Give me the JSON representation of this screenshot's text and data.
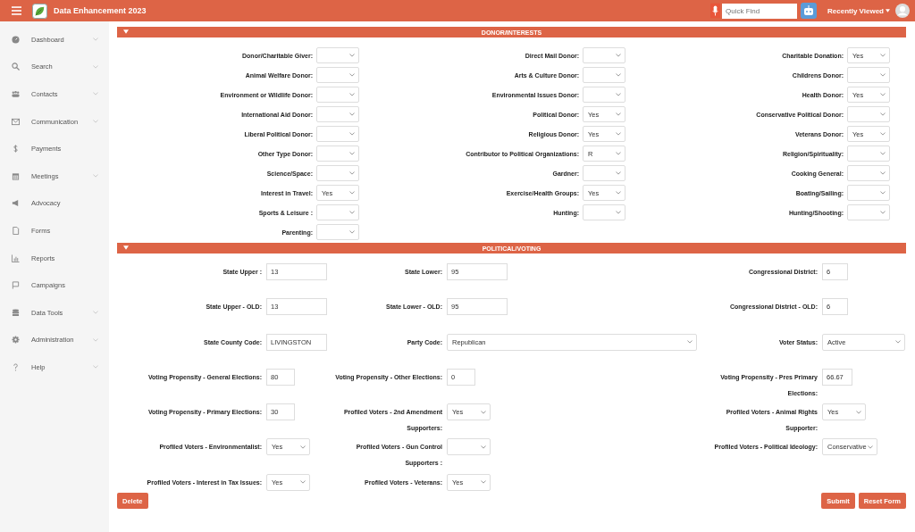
{
  "header": {
    "title": "Data Enhancement 2023",
    "search": {
      "placeholder": "Quick Find"
    },
    "recent": "Recently Viewed"
  },
  "sidebar": {
    "items": [
      {
        "label": "Dashboard",
        "has_submenu": true
      },
      {
        "label": "Search",
        "has_submenu": true
      },
      {
        "label": "Contacts",
        "has_submenu": true
      },
      {
        "label": "Communication",
        "has_submenu": true
      },
      {
        "label": "Payments",
        "has_submenu": false
      },
      {
        "label": "Meetings",
        "has_submenu": true
      },
      {
        "label": "Advocacy",
        "has_submenu": false
      },
      {
        "label": "Forms",
        "has_submenu": false
      },
      {
        "label": "Reports",
        "has_submenu": false
      },
      {
        "label": "Campaigns",
        "has_submenu": false
      },
      {
        "label": "Data Tools",
        "has_submenu": true
      },
      {
        "label": "Administration",
        "has_submenu": true
      },
      {
        "label": "Help",
        "has_submenu": true
      }
    ]
  },
  "donor_section": {
    "title": "DONOR/INTERESTS",
    "expanded": true,
    "fields": [
      {
        "label": "Donor/Charitable Giver:"
      },
      {
        "label": "Direct Mail Donor:"
      },
      {
        "label": "Charitable Donation:",
        "value": "Yes"
      },
      {
        "label": "Animal Welfare Donor:"
      },
      {
        "label": "Arts & Culture Donor:"
      },
      {
        "label": "Childrens Donor:"
      },
      {
        "label": "Environment or Wildlife Donor:"
      },
      {
        "label": "Environmental Issues Donor:"
      },
      {
        "label": "Health Donor:",
        "value": "Yes"
      },
      {
        "label": "International Aid Donor:"
      },
      {
        "label": "Political Donor:",
        "value": "Yes"
      },
      {
        "label": "Conservative Political Donor:"
      },
      {
        "label": "Liberal Political Donor:"
      },
      {
        "label": "Religious Donor:",
        "value": "Yes"
      },
      {
        "label": "Veterans Donor:",
        "value": "Yes"
      },
      {
        "label": "Other Type Donor:"
      },
      {
        "label": "Contributor to Political Organizations:",
        "value": "R"
      },
      {
        "label": "Religion/Spirituality:"
      },
      {
        "label": "Science/Space:"
      },
      {
        "label": "Gardner:"
      },
      {
        "label": "Cooking General:"
      },
      {
        "label": "Interest in Travel:",
        "value": "Yes"
      },
      {
        "label": "Exercise/Health Groups:",
        "value": "Yes"
      },
      {
        "label": "Boating/Sailing:"
      },
      {
        "label": "Sports & Leisure :"
      },
      {
        "label": "Hunting:"
      },
      {
        "label": "Hunting/Shooting:"
      },
      {
        "label": "Parenting:"
      }
    ]
  },
  "political_section": {
    "title": "POLITICAL/VOTING",
    "expanded": true,
    "rows": [
      [
        {
          "kind": "input",
          "label": "State Upper :",
          "value": "13"
        },
        {
          "kind": "input",
          "label": "State Lower:",
          "value": "95"
        },
        {
          "kind": "input",
          "label": "Congressional District:",
          "value": "6"
        }
      ],
      [
        {
          "kind": "input",
          "label": "State Upper - OLD:",
          "value": "13"
        },
        {
          "kind": "input",
          "label": "State Lower - OLD:",
          "value": "95"
        },
        {
          "kind": "input",
          "label": "Congressional District - OLD:",
          "value": "6"
        }
      ],
      [
        {
          "kind": "input",
          "label": "State County Code:",
          "value": "LIVINGSTON"
        },
        {
          "kind": "select",
          "label": "Party Code:",
          "value": "Republican"
        },
        {
          "kind": "select",
          "label": "Voter Status:",
          "value": "Active"
        }
      ],
      [
        {
          "kind": "input",
          "label": "Voting Propensity - General Elections:",
          "value": "80"
        },
        {
          "kind": "input",
          "label": "Voting Propensity - Other Elections:",
          "value": "0"
        },
        {
          "kind": "input",
          "label": "Voting Propensity - Pres Primary Elections:",
          "value": "66.67"
        }
      ],
      [
        {
          "kind": "input",
          "label": "Voting Propensity - Primary Elections:",
          "value": "30"
        },
        {
          "kind": "select",
          "label": "Profiled Voters - 2nd Amendment Supporters:",
          "value": "Yes"
        },
        {
          "kind": "select",
          "label": "Profiled Voters - Animal Rights Supporter:",
          "value": "Yes"
        }
      ],
      [
        {
          "kind": "select",
          "label": "Profiled Voters - Environmentalist:",
          "value": "Yes"
        },
        {
          "kind": "select",
          "label": "Profiled Voters - Gun Control Supporters :"
        },
        {
          "kind": "select",
          "label": "Profiled Voters - Political Ideology:",
          "value": "Conservative"
        }
      ],
      [
        {
          "kind": "select",
          "label": "Profiled Voters - Interest in Tax Issues:",
          "value": "Yes"
        },
        {
          "kind": "select",
          "label": "Profiled Voters - Veterans:",
          "value": "Yes"
        }
      ]
    ]
  },
  "buttons": {
    "left": [
      "Delete"
    ],
    "right": [
      "Submit",
      "Reset Form"
    ]
  }
}
